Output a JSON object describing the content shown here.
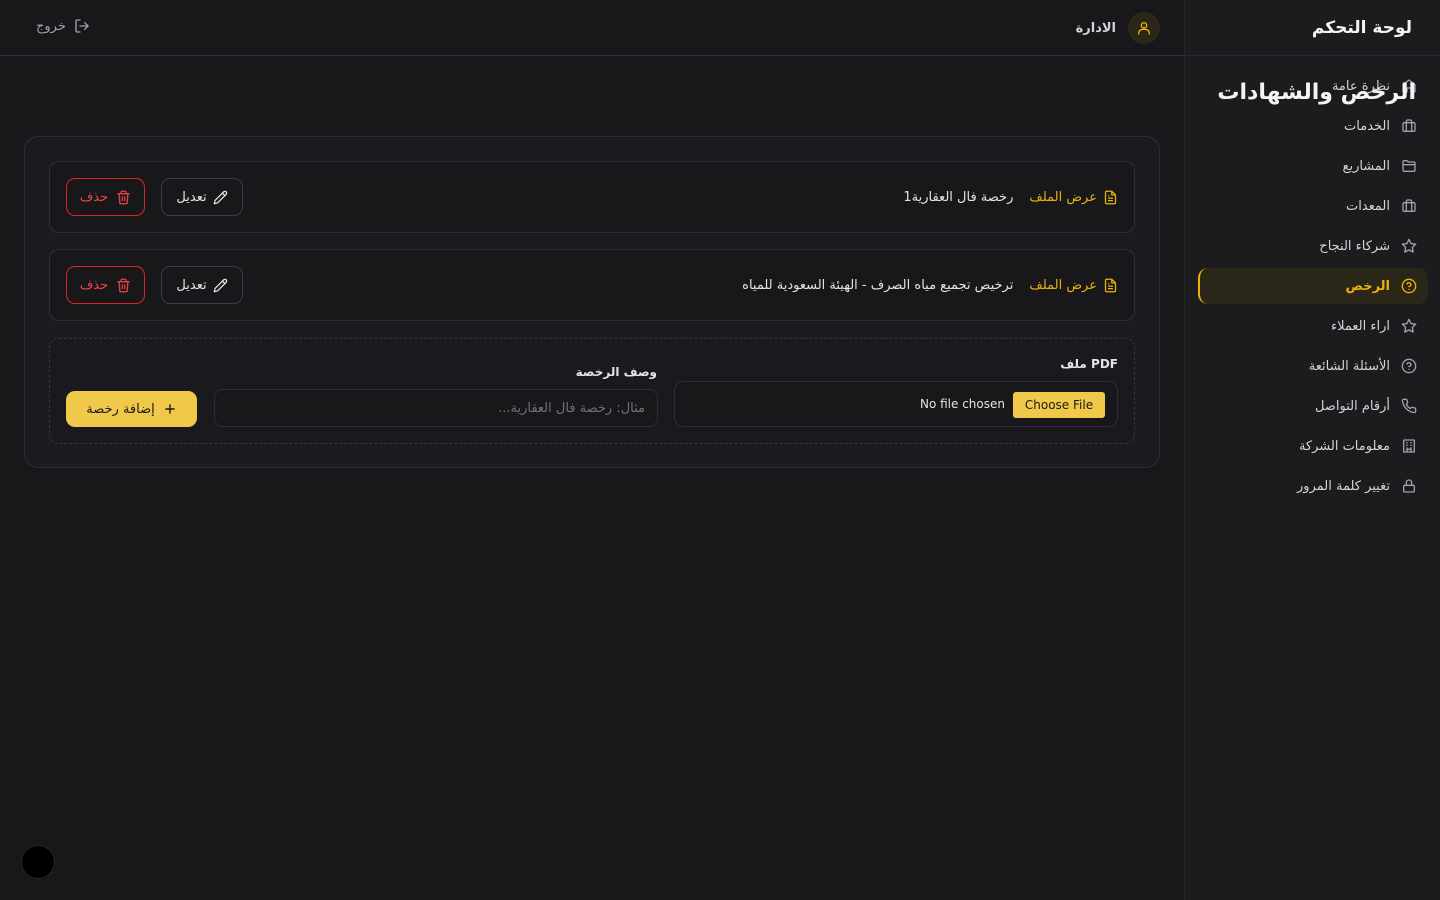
{
  "app": {
    "title": "لوحة التحكم"
  },
  "topbar": {
    "logout_label": "خروج",
    "user_name": "الادارة"
  },
  "sidebar": {
    "items": [
      {
        "label": "نظرة عامة",
        "icon": "home-icon",
        "active": false
      },
      {
        "label": "الخدمات",
        "icon": "briefcase-icon",
        "active": false
      },
      {
        "label": "المشاريع",
        "icon": "folder-icon",
        "active": false
      },
      {
        "label": "المعدات",
        "icon": "briefcase-icon",
        "active": false
      },
      {
        "label": "شركاء النجاح",
        "icon": "star-icon",
        "active": false
      },
      {
        "label": "الرخص",
        "icon": "help-circle-icon",
        "active": true
      },
      {
        "label": "اراء العملاء",
        "icon": "star-icon",
        "active": false
      },
      {
        "label": "الأسئلة الشائعة",
        "icon": "help-circle-icon",
        "active": false
      },
      {
        "label": "أرقام التواصل",
        "icon": "phone-icon",
        "active": false
      },
      {
        "label": "معلومات الشركة",
        "icon": "building-icon",
        "active": false
      },
      {
        "label": "تغيير كلمة المرور",
        "icon": "lock-icon",
        "active": false
      }
    ]
  },
  "main": {
    "page_title": "الرخص والشهادات",
    "licenses": [
      {
        "description": "رخصة فال العقارية1",
        "view_label": "عرض الملف",
        "edit_label": "تعديل",
        "delete_label": "حذف"
      },
      {
        "description": "ترخيص تجميع مياه الصرف - الهيئة السعودية للمياه",
        "view_label": "عرض الملف",
        "edit_label": "تعديل",
        "delete_label": "حذف"
      }
    ],
    "form": {
      "file_label": "ملف PDF",
      "choose_file_label": "Choose File",
      "no_file_text": "No file chosen",
      "description_label": "وصف الرخصة",
      "description_placeholder": "مثال: رخصة فال العقارية...",
      "description_value": "",
      "add_button_label": "إضافة رخصة"
    }
  },
  "colors": {
    "accent": "#eab308",
    "danger": "#ef4444",
    "background": "#18181b"
  }
}
